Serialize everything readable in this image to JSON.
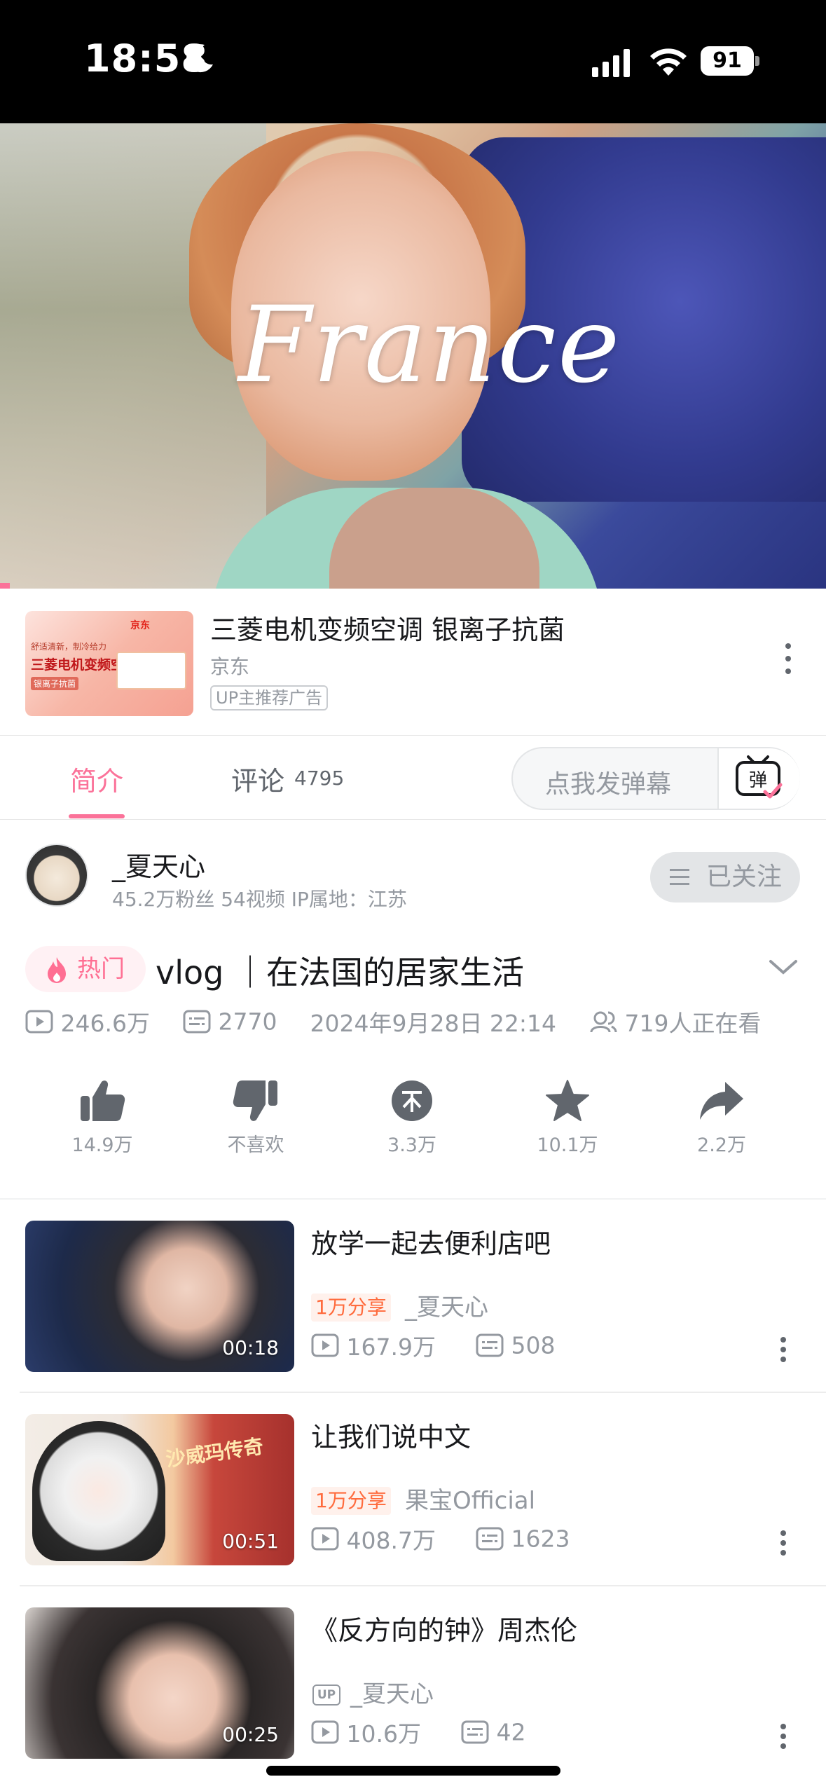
{
  "status_bar": {
    "time": "18:58",
    "battery": "91"
  },
  "video": {
    "overlay_title": "France"
  },
  "ad": {
    "title": "三菱电机变频空调 银离子抗菌",
    "source": "京东",
    "tag": "UP主推荐广告",
    "thumb_brand": "京东",
    "thumb_line1": "舒适清新，制冷给力",
    "thumb_line2": "三菱电机变频空调",
    "thumb_line3": "银离子抗菌"
  },
  "tabs": {
    "intro": "简介",
    "comments": "评论",
    "comments_count": "4795",
    "danmaku_placeholder": "点我发弹幕",
    "danmaku_icon_char": "弹"
  },
  "uploader": {
    "name": "_夏天心",
    "stats": "45.2万粉丝  54视频  IP属地：江苏",
    "follow_label": "已关注"
  },
  "video_info": {
    "hot_label": "热门",
    "title": "vlog ｜在法国的居家生活",
    "views": "246.6万",
    "danmaku_count": "2770",
    "date": "2024年9月28日 22:14",
    "watching": "719人正在看"
  },
  "actions": [
    {
      "label": "14.9万"
    },
    {
      "label": "不喜欢"
    },
    {
      "label": "3.3万"
    },
    {
      "label": "10.1万"
    },
    {
      "label": "2.2万"
    }
  ],
  "related": [
    {
      "title": "放学一起去便利店吧",
      "tag": "1万分享",
      "author": "_夏天心",
      "views": "167.9万",
      "danmaku": "508",
      "duration": "00:18"
    },
    {
      "title": "让我们说中文",
      "tag": "1万分享",
      "author": "果宝Official",
      "views": "408.7万",
      "danmaku": "1623",
      "duration": "00:51",
      "thumb_text": "沙威玛传奇"
    },
    {
      "title": "《反方向的钟》周杰伦",
      "tag": "UP",
      "author": "_夏天心",
      "views": "10.6万",
      "danmaku": "42",
      "duration": "00:25"
    }
  ],
  "colors": {
    "accent": "#fb7299",
    "secondary_text": "#9499a0",
    "share_tag": "#ff6b3d"
  }
}
